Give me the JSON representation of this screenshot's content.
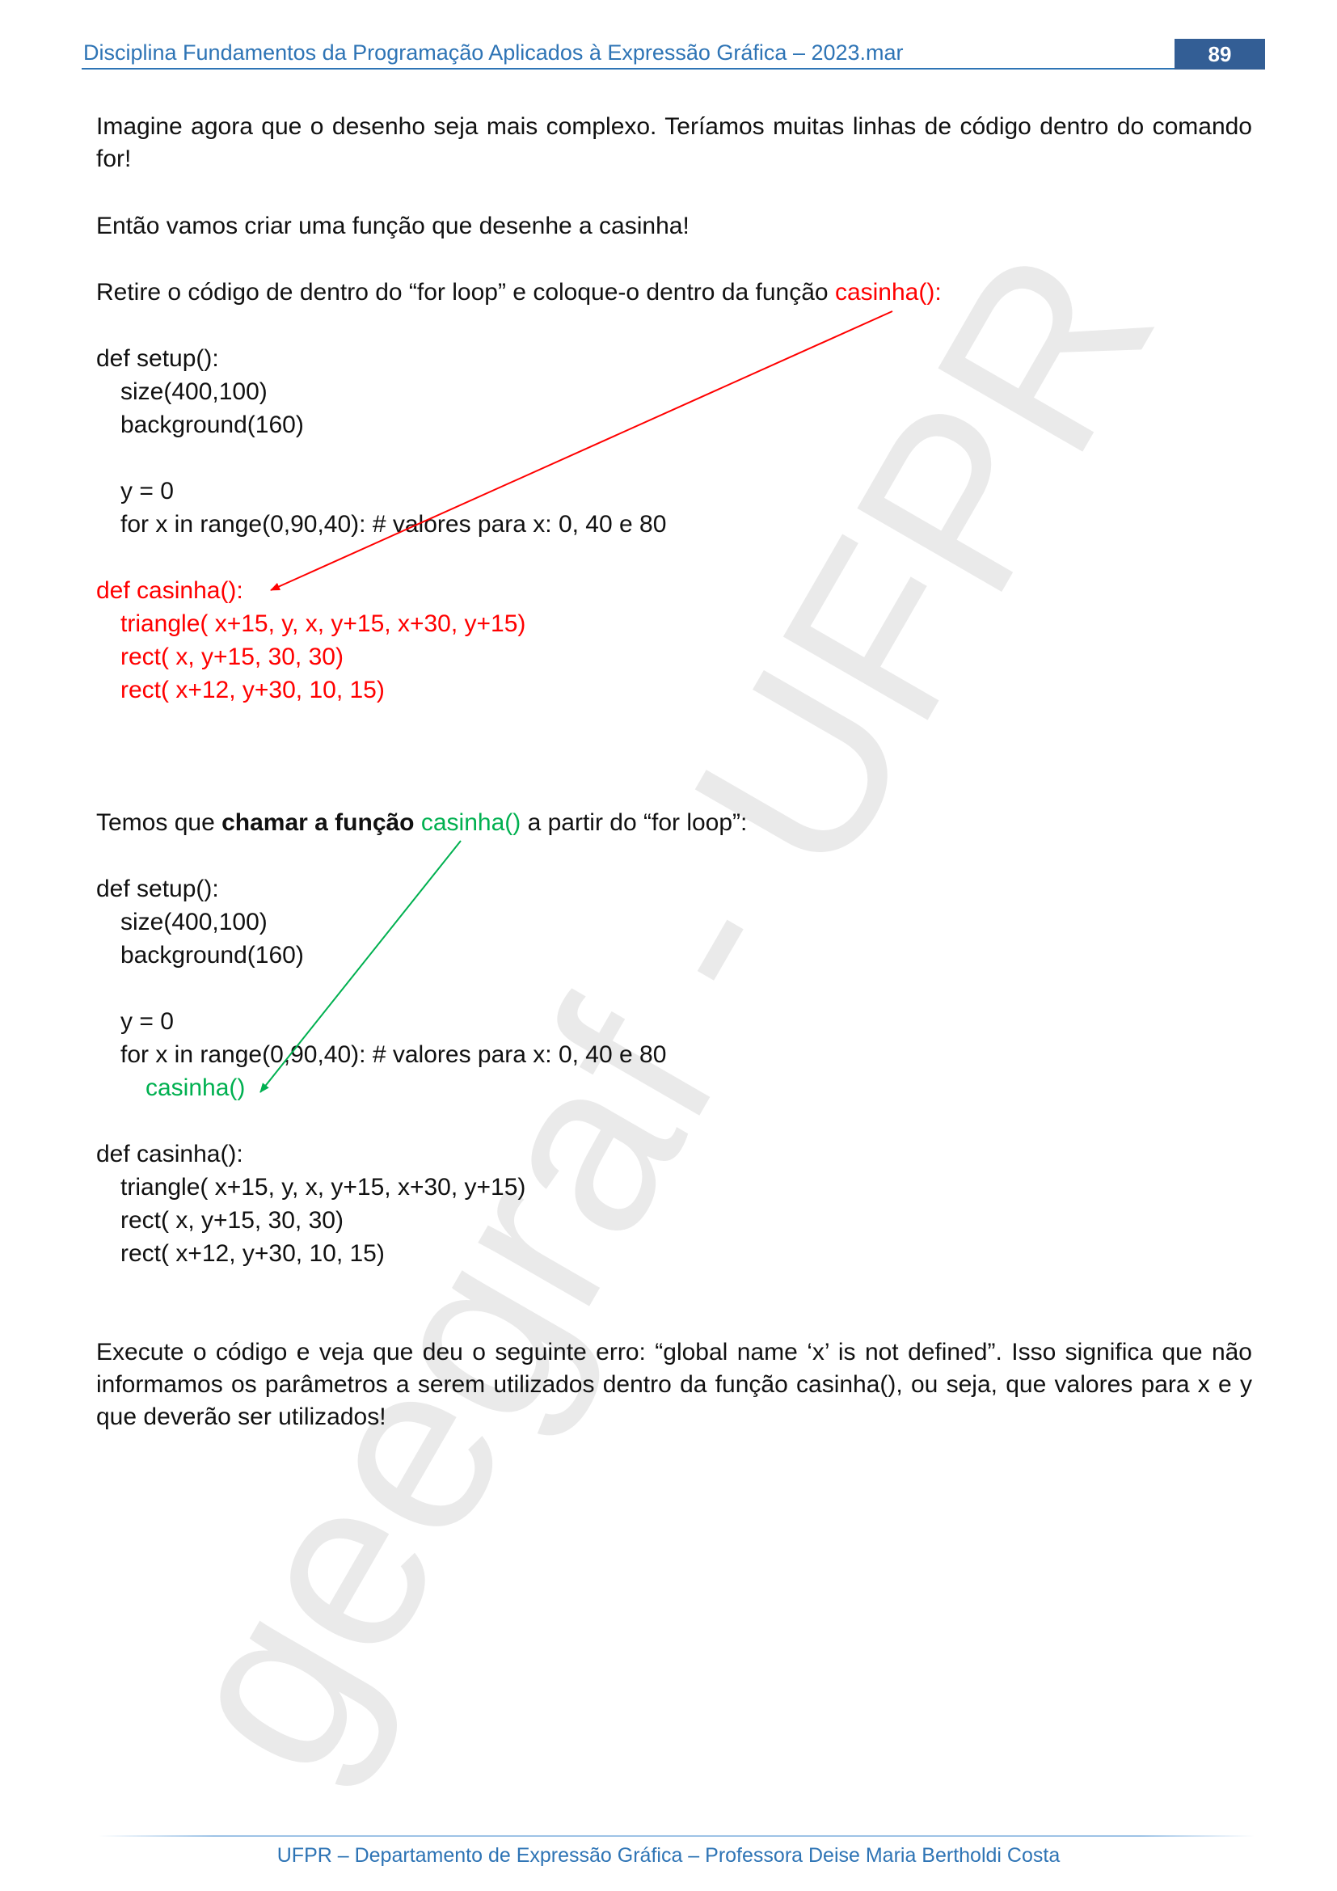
{
  "header": {
    "title": "Disciplina Fundamentos da Programação Aplicados à Expressão Gráfica – 2023.mar",
    "page_number": "89"
  },
  "watermark": "geegraf - UFPR",
  "body": {
    "p1": "Imagine agora que o desenho seja mais complexo. Teríamos muitas linhas de código dentro do comando for!",
    "p2": "Então vamos criar uma função que desenhe a casinha!",
    "p3_text": "Retire o código de dentro do “for loop” e coloque-o dentro da função ",
    "p3_highlight": "casinha():",
    "code1": {
      "l1": "def setup():",
      "l2": "size(400,100)",
      "l3": "background(160)",
      "l4": "y = 0",
      "l5": "for x in range(0,90,40):  # valores para x: 0, 40 e 80",
      "l6": "def casinha():",
      "l7": "triangle( x+15, y, x, y+15, x+30, y+15)",
      "l8": "rect( x, y+15, 30, 30)",
      "l9": "rect( x+12, y+30, 10, 15)"
    },
    "p4_a": "Temos que ",
    "p4_bold": "chamar a função",
    "p4_b": " ",
    "p4_green": "casinha()",
    "p4_c": " a partir do “for loop”:",
    "code2": {
      "l1": "def setup():",
      "l2": "size(400,100)",
      "l3": "background(160)",
      "l4": "y = 0",
      "l5": "for x in range(0,90,40):  # valores para x: 0, 40 e 80",
      "l6": "casinha()",
      "l7": "def casinha():",
      "l8": "triangle( x+15, y, x, y+15, x+30, y+15)",
      "l9": "rect( x, y+15, 30, 30)",
      "l10": "rect( x+12, y+30, 10, 15)"
    },
    "p5": "Execute o código e veja que deu o seguinte erro: “global name ‘x’ is not defined”. Isso significa que não informamos os parâmetros a serem utilizados dentro da função casinha(), ou seja, que valores para x e y que deverão ser utilizados!"
  },
  "footer": {
    "text": "UFPR – Departamento de Expressão Gráfica – Professora Deise Maria Bertholdi Costa"
  },
  "colors": {
    "header_blue": "#2e74b5",
    "badge_blue": "#335e95",
    "red": "#ff0000",
    "green": "#00b050"
  }
}
